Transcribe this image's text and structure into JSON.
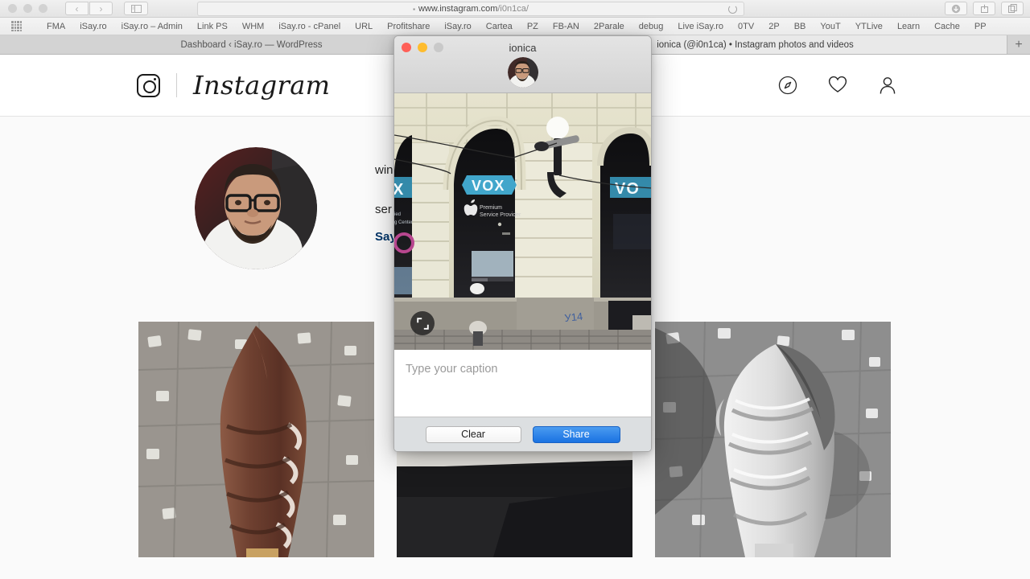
{
  "browser": {
    "url_domain": "www.instagram.com",
    "url_path": "/i0n1ca/",
    "lock_glyph": "▪",
    "back_glyph": "‹",
    "forward_glyph": "›",
    "bookmarks": [
      {
        "label": "FMA"
      },
      {
        "label": "iSay.ro"
      },
      {
        "label": "iSay.ro – Admin"
      },
      {
        "label": "Link PS"
      },
      {
        "label": "WHM"
      },
      {
        "label": "iSay.ro - cPanel"
      },
      {
        "label": "URL"
      },
      {
        "label": "Profitshare"
      },
      {
        "label": "iSay.ro"
      },
      {
        "label": "Cartea"
      },
      {
        "label": "PZ"
      },
      {
        "label": "FB-AN"
      },
      {
        "label": "2Parale"
      },
      {
        "label": "debug"
      },
      {
        "label": "Live iSay.ro"
      },
      {
        "label": "0TV"
      },
      {
        "label": "2P"
      },
      {
        "label": "BB"
      },
      {
        "label": "YouT"
      },
      {
        "label": "YTLive"
      },
      {
        "label": "Learn"
      },
      {
        "label": "Cache"
      },
      {
        "label": "PP"
      }
    ],
    "tabs": [
      {
        "title": "Dashboard ‹ iSay.ro — WordPress",
        "active": false
      },
      {
        "title": "ionica (@i0n1ca) • Instagram photos and videos",
        "active": true
      }
    ],
    "new_tab_glyph": "+"
  },
  "instagram": {
    "logo_text": "Instagram",
    "nav_icons": [
      {
        "name": "explore-compass-icon"
      },
      {
        "name": "activity-heart-icon"
      },
      {
        "name": "profile-person-icon"
      }
    ],
    "bio": {
      "line1_visible": "wing",
      "line2_visible": "ser (iPhone, iPad, MacBook, AppleTV),",
      "link_visible": "Say.ro"
    },
    "grid": [
      {
        "name": "chocolate-soft-serve-cone"
      },
      {
        "name": "car-dashboard-cluster"
      },
      {
        "name": "bw-soft-serve-cone"
      }
    ]
  },
  "uploader": {
    "window_title": "ionica",
    "caption_placeholder": "Type your caption",
    "clear_label": "Clear",
    "share_label": "Share",
    "expand_icon": "expand-crop-icon",
    "photo_description": "VOX Apple Premium Service Provider storefront"
  },
  "colors": {
    "share_blue": "#1a72e2",
    "bio_link": "#003569",
    "ig_text": "#262626",
    "page_bg": "#fafafa"
  }
}
